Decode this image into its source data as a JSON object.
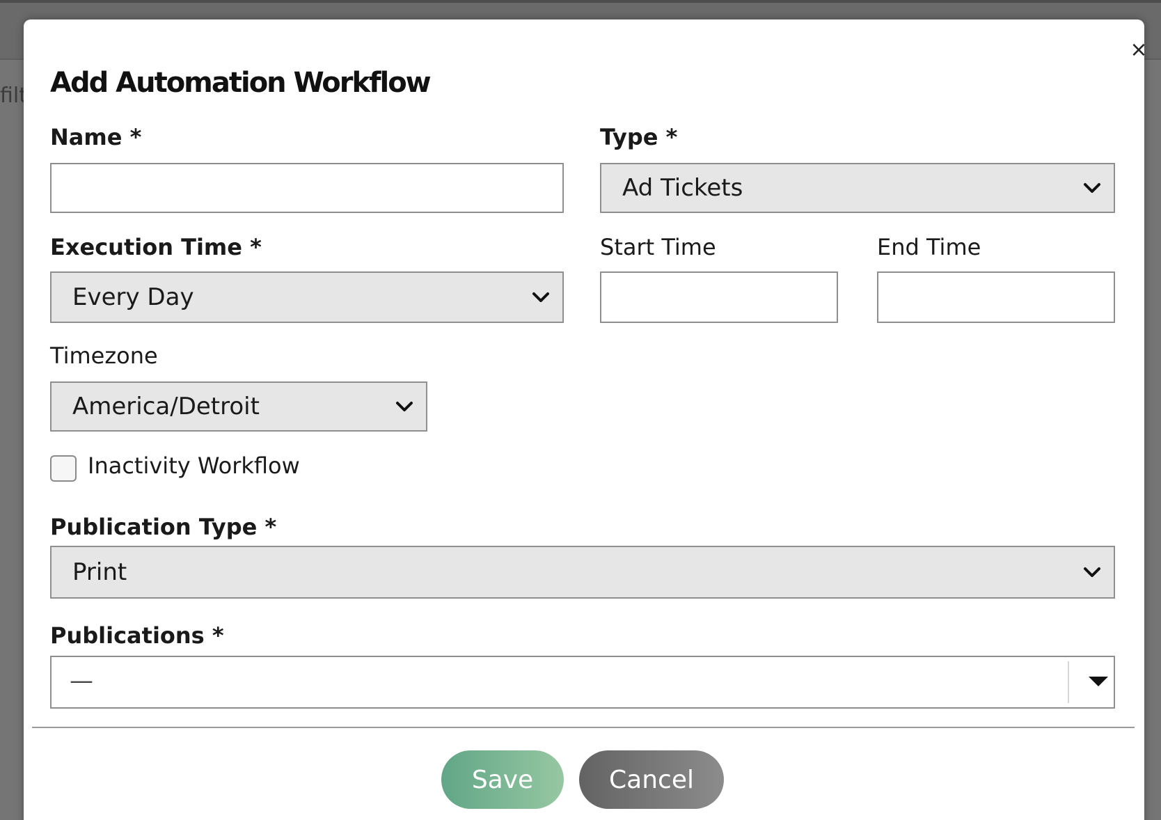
{
  "background": {
    "filter_text": "filt"
  },
  "dialog": {
    "title": "Add Automation Workflow",
    "close_label": "×"
  },
  "form": {
    "name": {
      "label": "Name *",
      "value": ""
    },
    "type": {
      "label": "Type *",
      "value": "Ad Tickets"
    },
    "execution_time": {
      "label": "Execution Time *",
      "value": "Every Day"
    },
    "start_time": {
      "label": "Start Time",
      "value": ""
    },
    "end_time": {
      "label": "End Time",
      "value": ""
    },
    "timezone": {
      "label": "Timezone",
      "value": "America/Detroit"
    },
    "inactivity_workflow": {
      "label": "Inactivity Workflow",
      "checked": false
    },
    "publication_type": {
      "label": "Publication Type *",
      "value": "Print"
    },
    "publications": {
      "label": "Publications *",
      "value": "—"
    }
  },
  "footer": {
    "save_label": "Save",
    "cancel_label": "Cancel"
  },
  "colors": {
    "overlay": "#757575",
    "save_start": "#61a687",
    "save_end": "#97c7a2",
    "cancel": "#737373",
    "select_bg": "#e6e6e6"
  },
  "icons": {
    "close": "close-icon",
    "select_arrow": "chevron-down-icon",
    "multiselect_arrow": "caret-down-icon"
  }
}
